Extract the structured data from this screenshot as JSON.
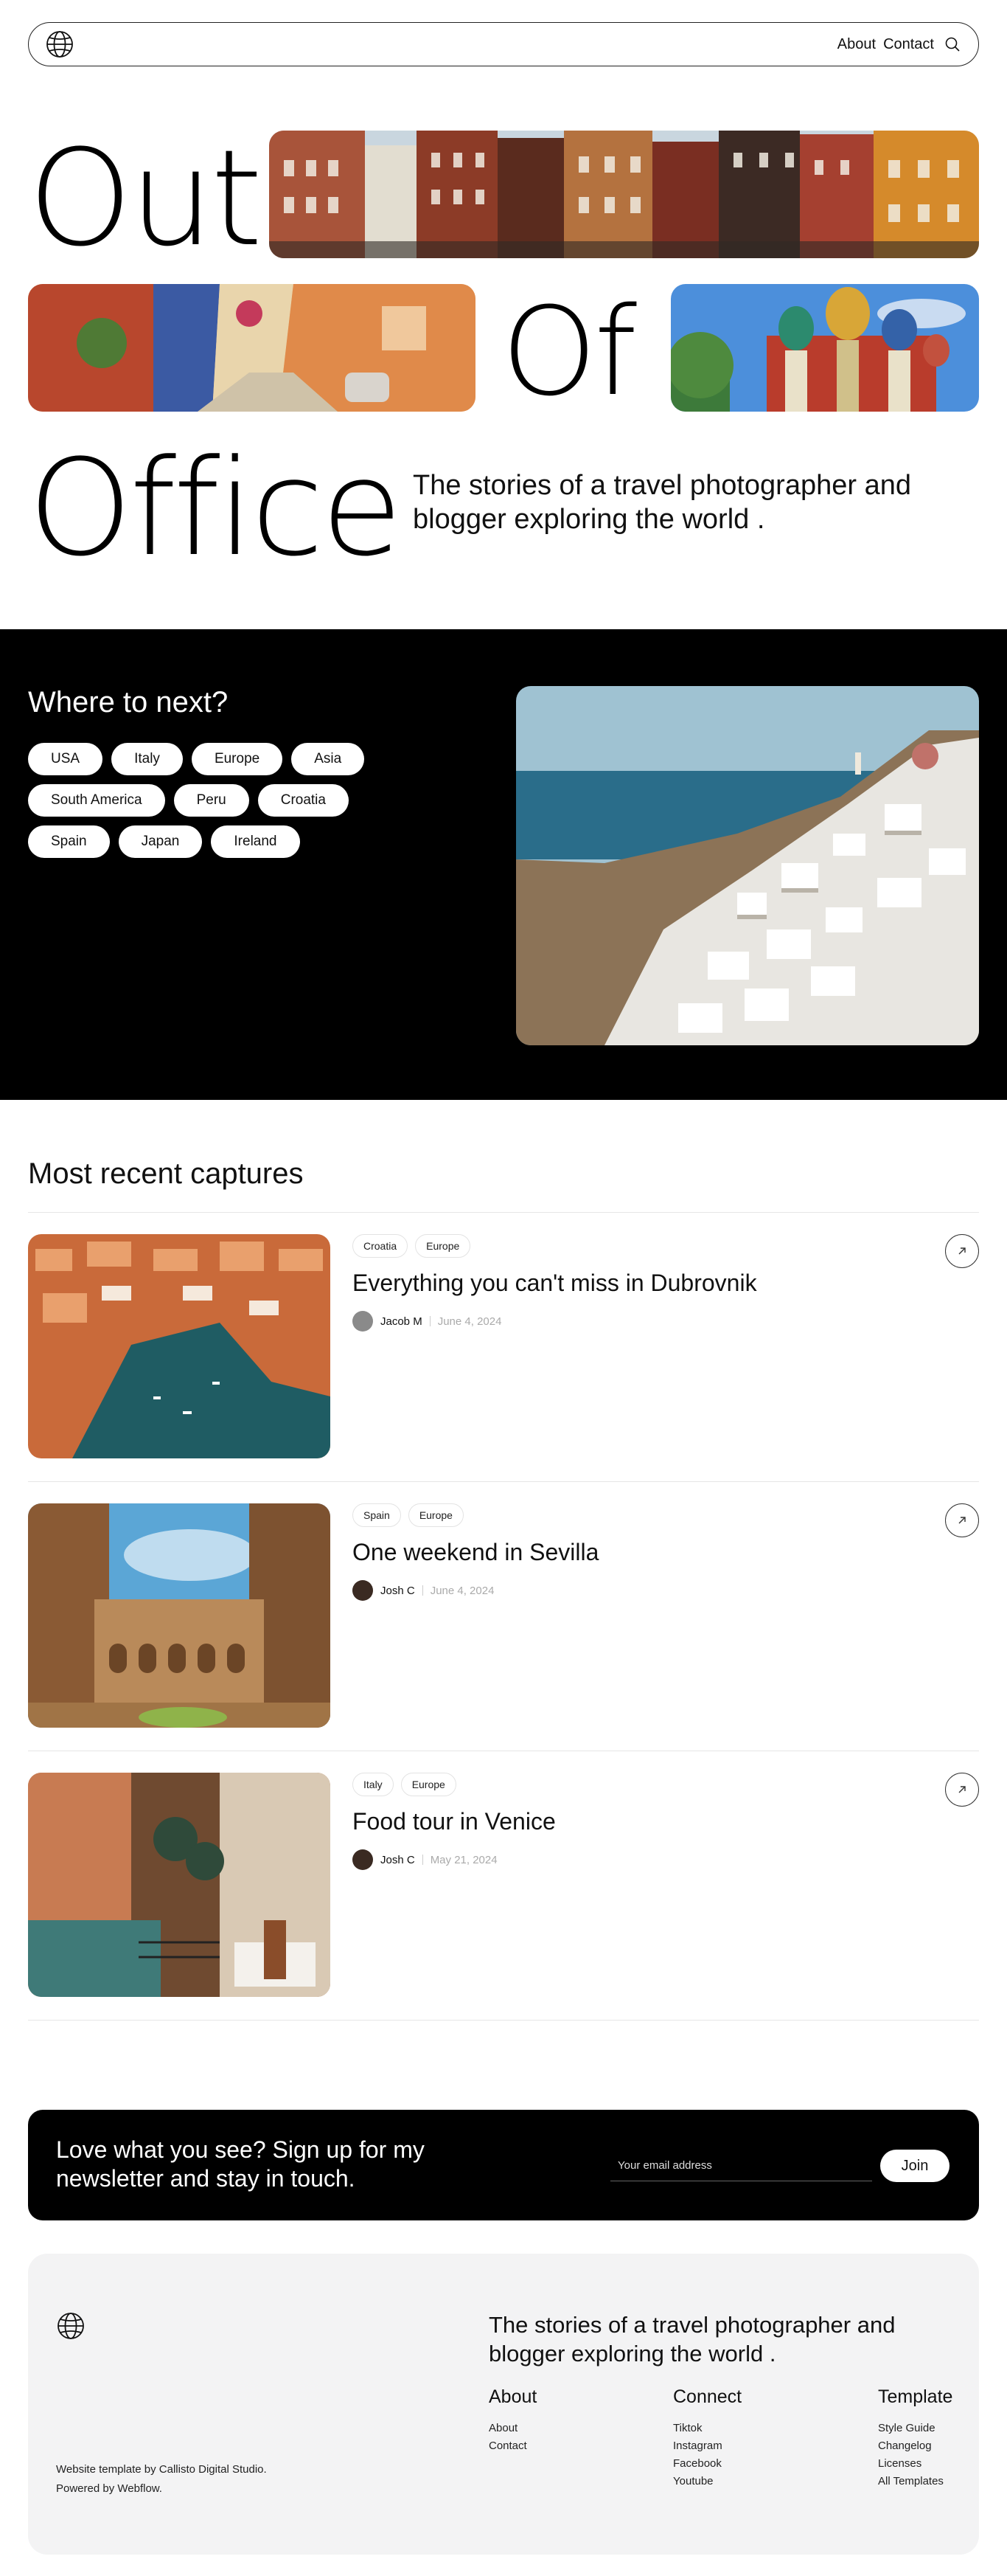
{
  "nav": {
    "links": [
      "About",
      "Contact"
    ]
  },
  "hero": {
    "word1": "Out",
    "word2": "Of",
    "word3": "Office",
    "tagline": "The stories of a travel photographer and blogger exploring the world ."
  },
  "destinations": {
    "title": "Where to next?",
    "chips": [
      "USA",
      "Italy",
      "Europe",
      "Asia",
      "South America",
      "Peru",
      "Croatia",
      "Spain",
      "Japan",
      "Ireland"
    ]
  },
  "recent": {
    "title": "Most recent captures",
    "posts": [
      {
        "tags": [
          "Croatia",
          "Europe"
        ],
        "title": "Everything you can't miss in Dubrovnik",
        "author": "Jacob M",
        "date": "June 4, 2024"
      },
      {
        "tags": [
          "Spain",
          "Europe"
        ],
        "title": "One weekend in Sevilla",
        "author": "Josh C",
        "date": "June 4, 2024"
      },
      {
        "tags": [
          "Italy",
          "Europe"
        ],
        "title": "Food tour in Venice",
        "author": "Josh C",
        "date": "May 21, 2024"
      }
    ]
  },
  "newsletter": {
    "text": "Love what you see? Sign up for my newsletter and stay in touch.",
    "placeholder": "Your email address",
    "button": "Join"
  },
  "footer": {
    "tagline": "The stories of a travel photographer and blogger exploring the world .",
    "credit1": "Website template by Callisto Digital Studio.",
    "credit2": "Powered by Webflow.",
    "columns": [
      {
        "title": "About",
        "links": [
          "About",
          "Contact"
        ]
      },
      {
        "title": "Connect",
        "links": [
          "Tiktok",
          "Instagram",
          "Facebook",
          "Youtube"
        ]
      },
      {
        "title": "Template",
        "links": [
          "Style Guide",
          "Changelog",
          "Licenses",
          "All Templates"
        ]
      }
    ]
  },
  "icons": [
    "globe-icon",
    "search-icon",
    "arrow-up-right-icon"
  ]
}
